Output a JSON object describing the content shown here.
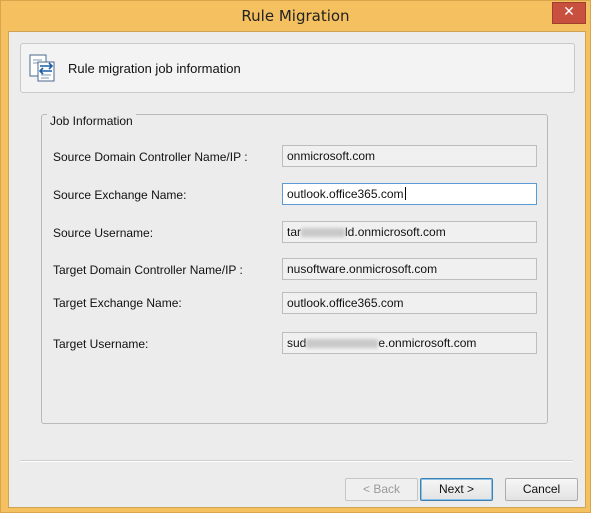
{
  "window": {
    "title": "Rule Migration",
    "close_glyph": "✕"
  },
  "header": {
    "icon": "rule-migration-icon",
    "text": "Rule migration job information"
  },
  "groupbox": {
    "legend": "Job Information"
  },
  "fields": [
    {
      "label": "Source Domain Controller Name/IP :",
      "value": "onmicrosoft.com"
    },
    {
      "label": "Source Exchange Name:",
      "value": "outlook.office365.com"
    },
    {
      "label": "Source Username:",
      "value_prefix": "tar",
      "value_suffix": "ld.onmicrosoft.com"
    },
    {
      "label": "Target Domain Controller Name/IP :",
      "value": "nusoftware.onmicrosoft.com"
    },
    {
      "label": "Target Exchange Name:",
      "value": "outlook.office365.com"
    },
    {
      "label": "Target Username:",
      "value_prefix": "sud",
      "value_suffix": "e.onmicrosoft.com"
    }
  ],
  "buttons": {
    "back": "< Back",
    "next": "Next >",
    "cancel": "Cancel"
  },
  "colors": {
    "title_bar": "#f5c060",
    "close_button": "#c7503e",
    "focus_border": "#5a9bd6"
  }
}
